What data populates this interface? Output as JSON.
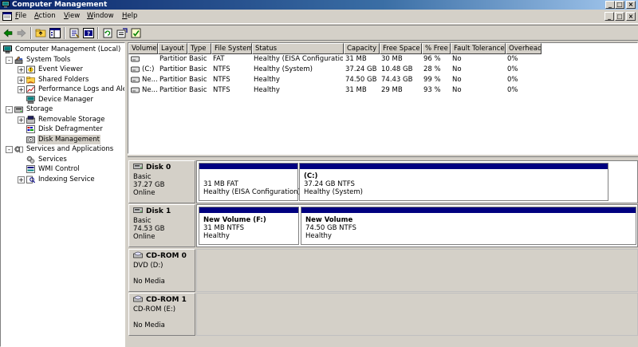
{
  "window": {
    "title": "Computer Management",
    "caption_buttons": [
      "_",
      "□",
      "×"
    ],
    "mdi_buttons": [
      "_",
      "□",
      "×"
    ]
  },
  "menu": [
    "File",
    "Action",
    "View",
    "Window",
    "Help"
  ],
  "toolbar": [
    "back-icon",
    "forward-icon",
    "up-folder-icon",
    "show-tree-icon",
    "properties-icon",
    "help-icon",
    "refresh-icon",
    "export-icon",
    "help-topic-icon"
  ],
  "tree": [
    {
      "label": "Computer Management (Local)",
      "icon": "computer-icon",
      "level": 0,
      "expander": ""
    },
    {
      "label": "System Tools",
      "icon": "tools-icon",
      "level": 1,
      "expander": "-"
    },
    {
      "label": "Event Viewer",
      "icon": "event-viewer-icon",
      "level": 2,
      "expander": "+"
    },
    {
      "label": "Shared Folders",
      "icon": "shared-folder-icon",
      "level": 2,
      "expander": "+"
    },
    {
      "label": "Performance Logs and Alerts",
      "icon": "performance-icon",
      "level": 2,
      "expander": "+"
    },
    {
      "label": "Device Manager",
      "icon": "device-manager-icon",
      "level": 2,
      "expander": ""
    },
    {
      "label": "Storage",
      "icon": "storage-icon",
      "level": 1,
      "expander": "-"
    },
    {
      "label": "Removable Storage",
      "icon": "removable-storage-icon",
      "level": 2,
      "expander": "+"
    },
    {
      "label": "Disk Defragmenter",
      "icon": "defragmenter-icon",
      "level": 2,
      "expander": ""
    },
    {
      "label": "Disk Management",
      "icon": "disk-management-icon",
      "level": 2,
      "expander": "",
      "selected": true
    },
    {
      "label": "Services and Applications",
      "icon": "services-apps-icon",
      "level": 1,
      "expander": "-"
    },
    {
      "label": "Services",
      "icon": "services-icon",
      "level": 2,
      "expander": ""
    },
    {
      "label": "WMI Control",
      "icon": "wmi-icon",
      "level": 2,
      "expander": ""
    },
    {
      "label": "Indexing Service",
      "icon": "indexing-icon",
      "level": 2,
      "expander": "+"
    }
  ],
  "columns": [
    "Volume",
    "Layout",
    "Type",
    "File System",
    "Status",
    "Capacity",
    "Free Space",
    "% Free",
    "Fault Tolerance",
    "Overhead"
  ],
  "volumes": [
    [
      "",
      "Partition",
      "Basic",
      "FAT",
      "Healthy (EISA Configuration)",
      "31 MB",
      "30 MB",
      "96 %",
      "No",
      "0%"
    ],
    [
      "(C:)",
      "Partition",
      "Basic",
      "NTFS",
      "Healthy (System)",
      "37.24 GB",
      "10.48 GB",
      "28 %",
      "No",
      "0%"
    ],
    [
      "Ne...",
      "Partition",
      "Basic",
      "NTFS",
      "Healthy",
      "74.50 GB",
      "74.43 GB",
      "99 %",
      "No",
      "0%"
    ],
    [
      "Ne...",
      "Partition",
      "Basic",
      "NTFS",
      "Healthy",
      "31 MB",
      "29 MB",
      "93 %",
      "No",
      "0%"
    ]
  ],
  "disks": [
    {
      "name": "Disk 0",
      "icon": "disk-icon",
      "lines": [
        "Basic",
        "37.27 GB",
        "Online"
      ],
      "partitions": [
        {
          "title": "",
          "lines": [
            "31 MB FAT",
            "Healthy (EISA Configuration)"
          ]
        },
        {
          "title": "(C:)",
          "lines": [
            "37.24 GB NTFS",
            "Healthy (System)"
          ]
        }
      ]
    },
    {
      "name": "Disk 1",
      "icon": "disk-icon",
      "lines": [
        "Basic",
        "74.53 GB",
        "Online"
      ],
      "partitions": [
        {
          "title": "New Volume  (F:)",
          "lines": [
            "31 MB NTFS",
            "Healthy"
          ]
        },
        {
          "title": "New Volume",
          "lines": [
            "74.50 GB NTFS",
            "Healthy"
          ]
        }
      ]
    },
    {
      "name": "CD-ROM 0",
      "icon": "cdrom-icon",
      "lines": [
        "DVD (D:)",
        "",
        "No Media"
      ],
      "partitions": []
    },
    {
      "name": "CD-ROM 1",
      "icon": "cdrom-icon",
      "lines": [
        "CD-ROM (E:)",
        "",
        "No Media"
      ],
      "partitions": []
    }
  ]
}
